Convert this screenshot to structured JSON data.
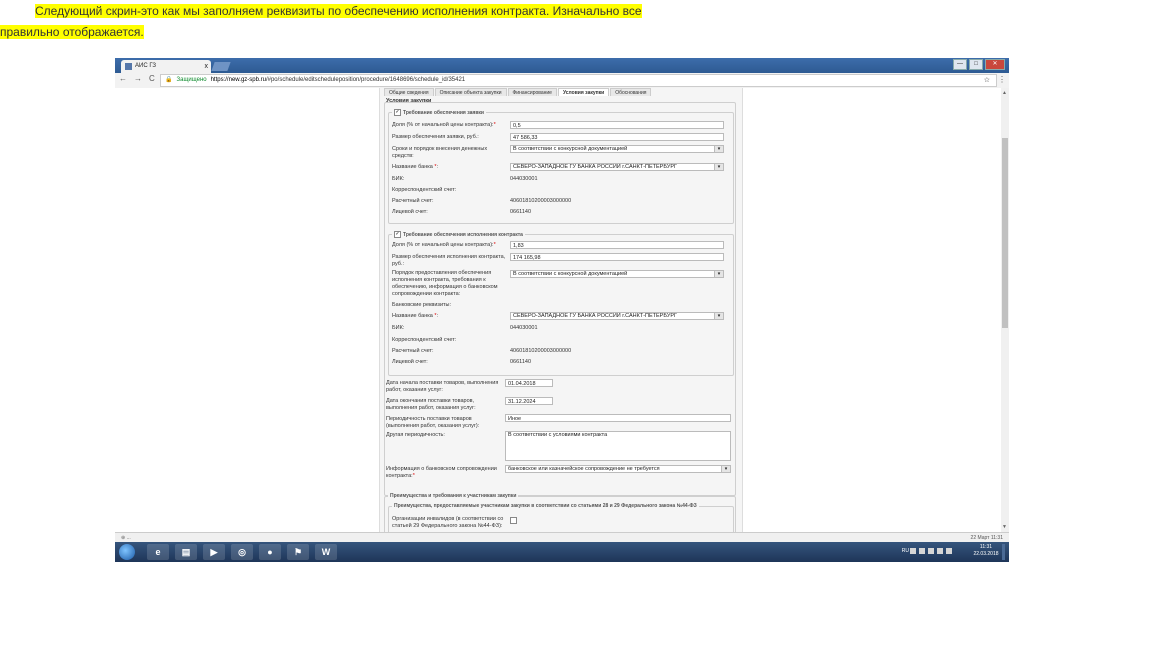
{
  "intro": {
    "line1": "Следующий скрин-это как мы заполняем реквизиты по обеспечению исполнения контракта. Изначально все",
    "line2": "правильно отображается."
  },
  "browser": {
    "tab_title": "АИС ГЗ",
    "tab_close": "x",
    "secure_label": "Защищено",
    "url_host": "https://new.gz-spb.ru",
    "url_path": "/#po/schedule/editscheduleposition/procedure/1648696/schedule_id/35421",
    "window_buttons": [
      "—",
      "□",
      "✕"
    ]
  },
  "page_tabs": [
    "Общие сведения",
    "Описание объекта закупки",
    "Финансирование",
    "Условия закупки",
    "Обоснования"
  ],
  "active_tab": "Условия закупки",
  "section_title": "Условия закупки",
  "bid_security": {
    "legend": "Требование обеспечения заявки",
    "share_label": "Доля (% от начальной цены контракта):",
    "share_value": "0,5",
    "amount_label": "Размер обеспечения заявки, руб.:",
    "amount_value": "47 586,33",
    "terms_label": "Сроки и порядок внесения денежных средств:",
    "terms_value": "В соответствии с конкурсной документацией",
    "bank_label": "Название банка",
    "bank_value": "СЕВЕРО-ЗАПАДНОЕ ГУ БАНКА РОССИИ г.САНКТ-ПЕТЕРБУРГ",
    "bik_label": "БИК:",
    "bik_value": "044030001",
    "corr_label": "Корреспондентский счет:",
    "account_label": "Расчетный счет:",
    "account_value": "40601810200003000000",
    "personal_label": "Лицевой счет:",
    "personal_value": "0661140"
  },
  "contract_security": {
    "legend": "Требование обеспечения исполнения контракта",
    "share_label": "Доля (% от начальной цены контракта):",
    "share_value": "1,83",
    "amount_label": "Размер обеспечения исполнения контракта, руб.:",
    "amount_value": "174 165,98",
    "procedure_label": "Порядок предоставления обеспечения исполнения контракта, требования к обеспечению, информация о банковском сопровождении контракта:",
    "procedure_value": "В соответствии с конкурсной документацией",
    "bank_details_label": "Банковские реквизиты:",
    "bank_label": "Название банка",
    "bank_value": "СЕВЕРО-ЗАПАДНОЕ ГУ БАНКА РОССИИ г.САНКТ-ПЕТЕРБУРГ",
    "bik_label": "БИК:",
    "bik_value": "044030001",
    "corr_label": "Корреспондентский счет:",
    "account_label": "Расчетный счет:",
    "account_value": "40601810200003000000",
    "personal_label": "Лицевой счет:",
    "personal_value": "0661140"
  },
  "delivery": {
    "start_label": "Дата начала поставки товаров, выполнения работ, оказания услуг:",
    "start_value": "01.04.2018",
    "end_label": "Дата окончания поставки товаров, выполнения работ, оказания услуг:",
    "end_value": "31.12.2024",
    "period_label": "Периодичность поставки товаров (выполнения работ, оказания услуг):",
    "period_value": "Иное",
    "other_label": "Другая периодичность:",
    "other_value": "В соответствии с условиями контракта",
    "bank_support_label": "Информация о банковском сопровождении контракта:",
    "bank_support_value": "банковское или казначейское сопровождение не требуется"
  },
  "advantages": {
    "legend": "Преимущества и требования к участникам закупки",
    "sub_legend": "Преимущества, предоставляемые участникам закупки в соответствии со статьями 28 и 29 Федерального закона №44-ФЗ",
    "disabled_orgs_label": "Организации инвалидов (в соответствии со статьей 29 Федерального закона №44-ФЗ):"
  },
  "required_mark": "*",
  "statusbar": {
    "left": "⊕ ...",
    "right": "22 Март 11:31"
  },
  "taskbar": {
    "apps": [
      "e",
      "▤",
      "▶",
      "◎",
      "●",
      "⚑",
      "W"
    ],
    "lang": "RU",
    "time": "11:31",
    "date": "22.03.2018"
  }
}
